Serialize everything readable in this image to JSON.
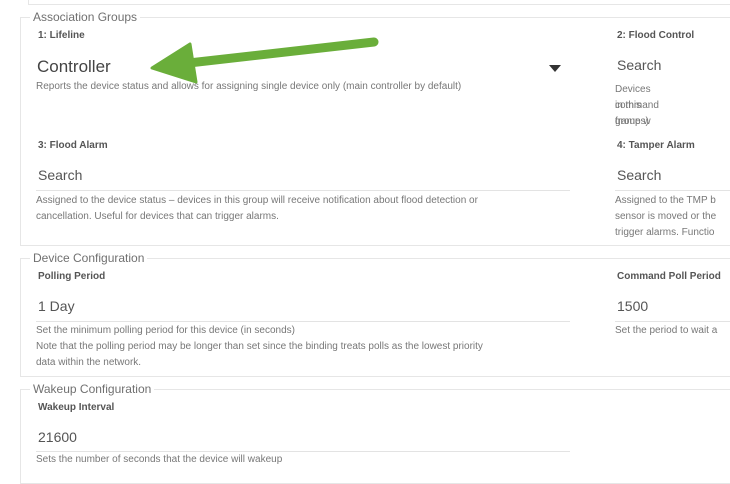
{
  "association": {
    "legend": "Association Groups",
    "lifeline": {
      "label": "1: Lifeline",
      "value": "Controller",
      "description": "Reports the device status and allows for assigning single device only (main controller by default)"
    },
    "flood_control": {
      "label": "2: Flood Control",
      "placeholder": "Search",
      "description_lines": [
        "Devices in this group w",
        "command frames)"
      ]
    },
    "flood_alarm": {
      "label": "3: Flood Alarm",
      "placeholder": "Search",
      "description_lines": [
        "Assigned to the device status – devices in this group will receive notification about flood detection or",
        "cancellation. Useful for devices that can trigger alarms."
      ]
    },
    "tamper_alarm": {
      "label": "4: Tamper Alarm",
      "placeholder": "Search",
      "description_lines": [
        "Assigned to the TMP b",
        "sensor is moved or the",
        "trigger alarms. Functio"
      ]
    }
  },
  "device_config": {
    "legend": "Device Configuration",
    "polling_period": {
      "label": "Polling Period",
      "value": "1 Day",
      "description_lines": [
        "Set the minimum polling period for this device (in seconds)",
        "Note that the polling period may be longer than set since the binding treats polls as the lowest priority",
        "data within the network."
      ]
    },
    "command_poll_period": {
      "label": "Command Poll Period",
      "value": "1500",
      "description_lines": [
        "Set the period to wait a"
      ]
    }
  },
  "wakeup_config": {
    "legend": "Wakeup Configuration",
    "wakeup_interval": {
      "label": "Wakeup Interval",
      "value": "21600",
      "description_lines": [
        "Sets the number of seconds that the device will wakeup"
      ]
    }
  },
  "colors": {
    "arrow": "#6aae3a",
    "border": "#e6e6e6"
  },
  "icons": {
    "dropdown": "caret-down-icon",
    "annotation": "arrow-pointer-icon"
  }
}
